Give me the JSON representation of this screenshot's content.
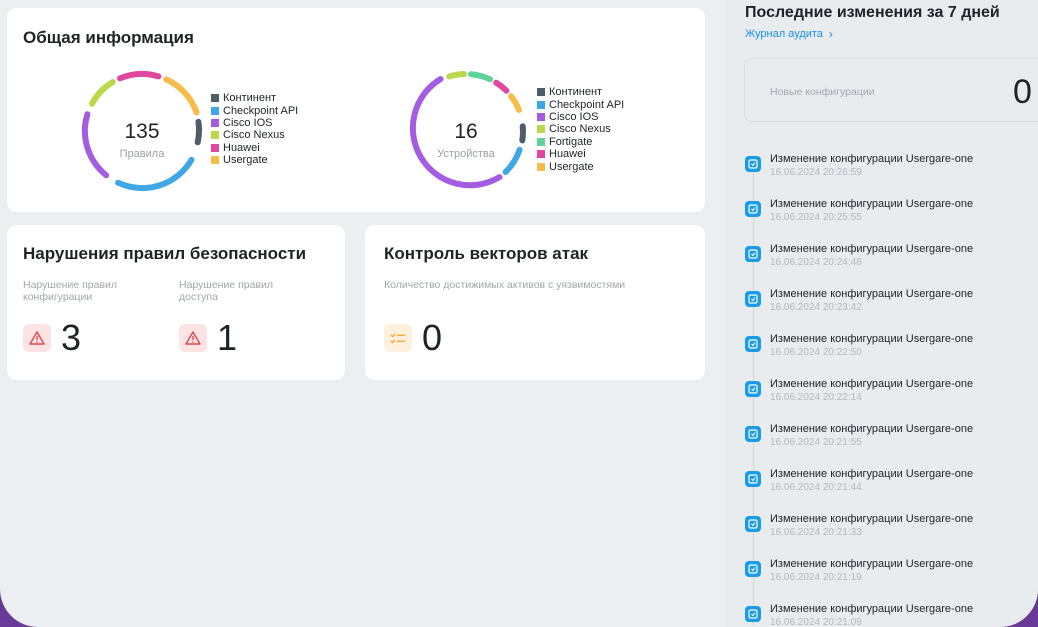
{
  "info": {
    "title": "Общая информация",
    "rules_donut": {
      "value": "135",
      "label": "Правила"
    },
    "devices_donut": {
      "value": "16",
      "label": "Устройства"
    },
    "rules_legend": [
      {
        "label": "Континент",
        "color": "#4f5d6a"
      },
      {
        "label": "Checkpoint API",
        "color": "#3fa7e6"
      },
      {
        "label": "Cisco IOS",
        "color": "#a45de0"
      },
      {
        "label": "Cisco Nexus",
        "color": "#b9d94a"
      },
      {
        "label": "Huawei",
        "color": "#e0479e"
      },
      {
        "label": "Usergate",
        "color": "#f6bd4c"
      }
    ],
    "devices_legend": [
      {
        "label": "Континент",
        "color": "#4f5d6a"
      },
      {
        "label": "Checkpoint API",
        "color": "#3fa7e6"
      },
      {
        "label": "Cisco IOS",
        "color": "#a45de0"
      },
      {
        "label": "Cisco Nexus",
        "color": "#b9d94a"
      },
      {
        "label": "Fortigate",
        "color": "#5fd39a"
      },
      {
        "label": "Huawei",
        "color": "#e0479e"
      },
      {
        "label": "Usergate",
        "color": "#f6bd4c"
      }
    ]
  },
  "violations": {
    "title": "Нарушения правил безопасности",
    "config_label": "Нарушение правил конфигурации",
    "config_value": "3",
    "access_label": "Нарушение правил доступа",
    "access_value": "1"
  },
  "attack": {
    "title": "Контроль векторов атак",
    "label": "Количество достижимых активов с уязвимостями",
    "value": "0"
  },
  "side": {
    "title": "Последние изменения за 7 дней",
    "audit_link": "Журнал аудита",
    "new_config_label": "Новые конфигурации",
    "new_config_value": "0",
    "events": [
      {
        "title": "Изменение конфигурации Usergare-one",
        "time": "16.06.2024 20:26:59"
      },
      {
        "title": "Изменение конфигурации Usergare-one",
        "time": "16.06.2024 20:25:55"
      },
      {
        "title": "Изменение конфигурации Usergare-one",
        "time": "16.06.2024 20:24:48"
      },
      {
        "title": "Изменение конфигурации Usergare-one",
        "time": "16.06.2024 20:23:42"
      },
      {
        "title": "Изменение конфигурации Usergare-one",
        "time": "16.06.2024 20:22:50"
      },
      {
        "title": "Изменение конфигурации Usergare-one",
        "time": "16.06.2024 20:22:14"
      },
      {
        "title": "Изменение конфигурации Usergare-one",
        "time": "16.06.2024 20:21:55"
      },
      {
        "title": "Изменение конфигурации Usergare-one",
        "time": "16.06.2024 20:21:44"
      },
      {
        "title": "Изменение конфигурации Usergare-one",
        "time": "16.06.2024 20:21:33"
      },
      {
        "title": "Изменение конфигурации Usergare-one",
        "time": "16.06.2024 20:21:19"
      },
      {
        "title": "Изменение конфигурации Usergare-one",
        "time": "16.06.2024 20:21:09"
      }
    ]
  },
  "colors": {
    "accent": "#1a9be8",
    "danger": "#e0484f",
    "warning": "#f5a623"
  }
}
